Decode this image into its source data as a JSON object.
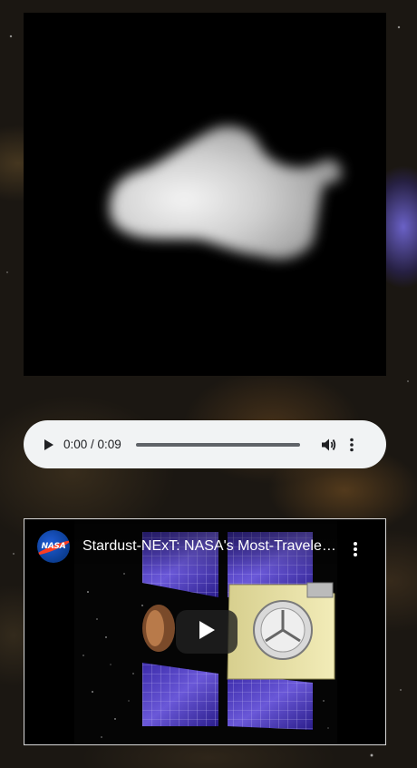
{
  "asteroid_image": {
    "icon": "asteroid-photo"
  },
  "audio": {
    "time_display": "0:00 / 0:09",
    "progress": 0,
    "play_icon": "play-icon",
    "volume_icon": "volume-icon",
    "menu_icon": "more-vert-icon"
  },
  "video": {
    "channel_logo_text": "NASA",
    "title": "Stardust-NExT: NASA's Most-Traveled Comet Hunter",
    "play_icon": "youtube-play-icon",
    "menu_icon": "more-vert-icon"
  },
  "colors": {
    "audio_bg": "#f1f3f4",
    "audio_text": "#202124",
    "youtube_play_bg": "#212121"
  }
}
